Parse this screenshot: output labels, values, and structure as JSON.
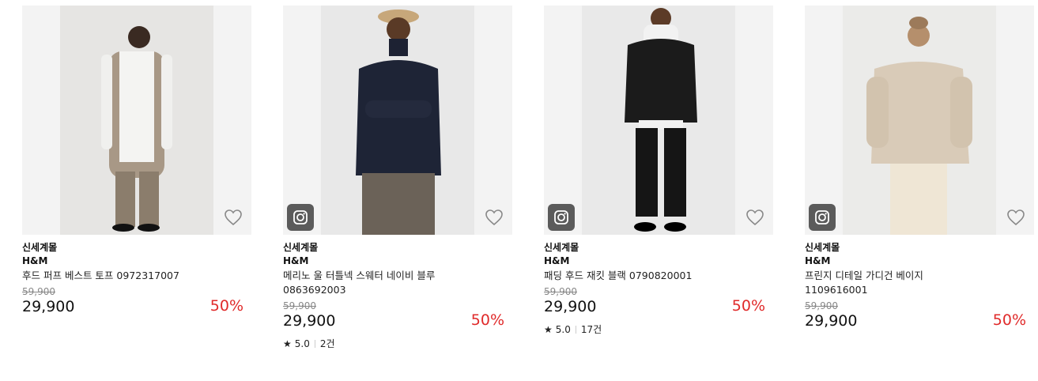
{
  "products": [
    {
      "seller": "신세계몰",
      "brand": "H&M",
      "name": "후드 퍼프 베스트 토프 0972317007",
      "original_price": "59,900",
      "price": "29,900",
      "discount": "50%",
      "has_instagram": false,
      "rating": null,
      "reviews": null
    },
    {
      "seller": "신세계몰",
      "brand": "H&M",
      "name": "메리노 울 터틀넥 스웨터 네이비 블루 0863692003",
      "original_price": "59,900",
      "price": "29,900",
      "discount": "50%",
      "has_instagram": true,
      "rating": "5.0",
      "reviews": "2건"
    },
    {
      "seller": "신세계몰",
      "brand": "H&M",
      "name": "패딩 후드 재킷 블랙 0790820001",
      "original_price": "59,900",
      "price": "29,900",
      "discount": "50%",
      "has_instagram": true,
      "rating": "5.0",
      "reviews": "17건"
    },
    {
      "seller": "신세계몰",
      "brand": "H&M",
      "name": "프린지 디테일 가디건 베이지 1109616001",
      "original_price": "59,900",
      "price": "29,900",
      "discount": "50%",
      "has_instagram": true,
      "rating": null,
      "reviews": null
    }
  ]
}
